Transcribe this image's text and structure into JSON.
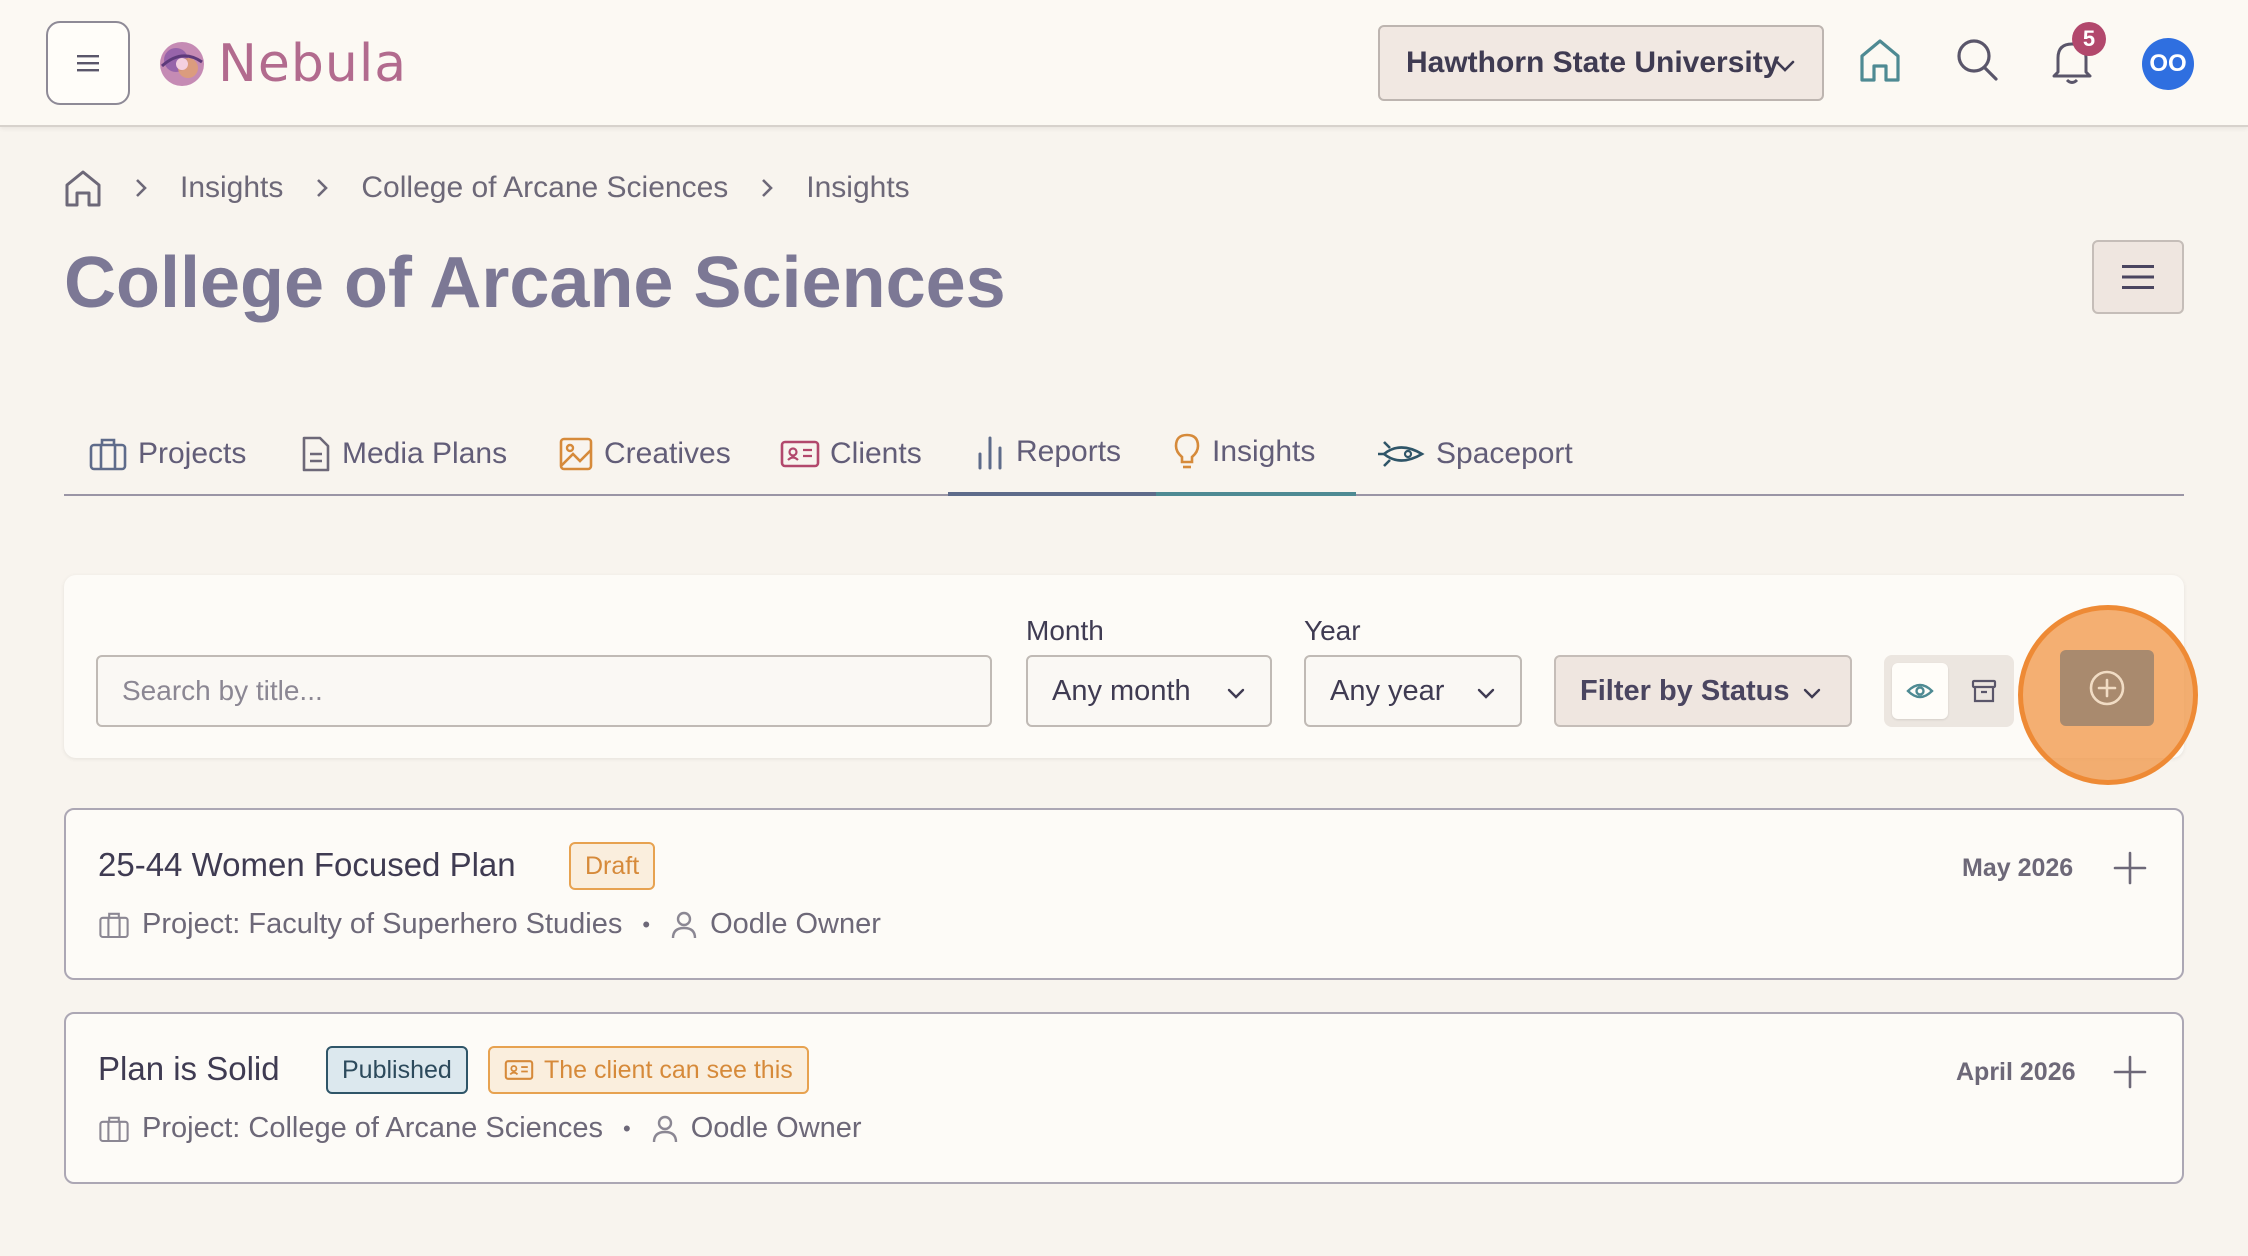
{
  "header": {
    "app_name": "Nebula",
    "org_selector": "Hawthorn State University",
    "notification_count": "5",
    "avatar_initials": "OO"
  },
  "breadcrumb": {
    "items": [
      "Insights",
      "College of Arcane Sciences",
      "Insights"
    ]
  },
  "page": {
    "title": "College of Arcane Sciences"
  },
  "tabs": [
    {
      "label": "Projects",
      "icon": "briefcase-icon"
    },
    {
      "label": "Media Plans",
      "icon": "document-icon"
    },
    {
      "label": "Creatives",
      "icon": "image-icon"
    },
    {
      "label": "Clients",
      "icon": "id-card-icon"
    },
    {
      "label": "Reports",
      "icon": "bar-chart-icon"
    },
    {
      "label": "Insights",
      "icon": "lightbulb-icon",
      "active": true
    },
    {
      "label": "Spaceport",
      "icon": "rocket-icon"
    }
  ],
  "filters": {
    "search_placeholder": "Search by title...",
    "month_label": "Month",
    "month_value": "Any month",
    "year_label": "Year",
    "year_value": "Any year",
    "status_button": "Filter by Status"
  },
  "items": [
    {
      "title": "25-44 Women Focused Plan",
      "status": "Draft",
      "project": "Project: Faculty of Superhero Studies",
      "owner": "Oodle Owner",
      "date": "May 2026"
    },
    {
      "title": "Plan is Solid",
      "status": "Published",
      "client_badge": "The client can see this",
      "project": "Project: College of Arcane Sciences",
      "owner": "Oodle Owner",
      "date": "April 2026"
    }
  ],
  "colors": {
    "background": "#f8f4ee",
    "accent_tab": "#4e8a93",
    "draft": "#e7a250",
    "published": "#2f5568",
    "highlight": "#ee8a35",
    "add_button": "#a98a6e"
  }
}
